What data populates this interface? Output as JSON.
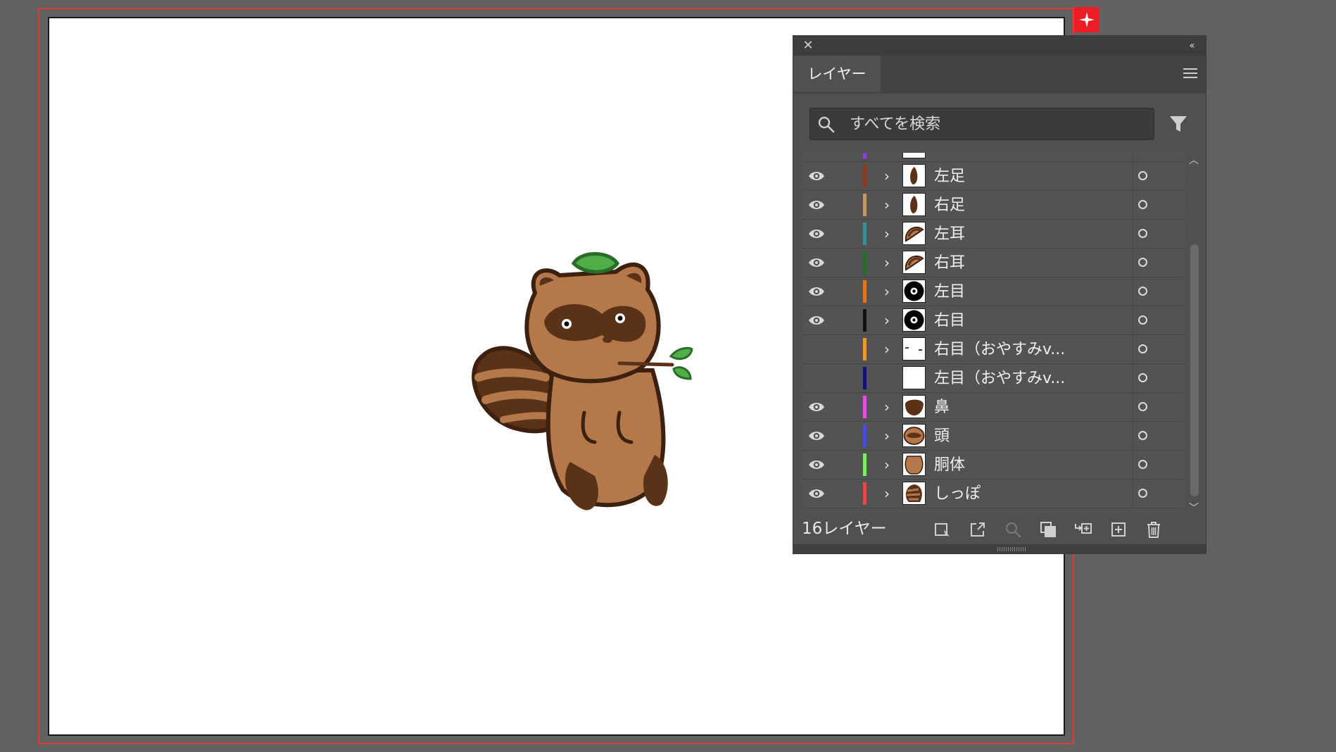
{
  "panel": {
    "close_glyph": "✕",
    "collapse_glyph": "‹‹",
    "tab_label": "レイヤー",
    "search_placeholder": "すべてを検索",
    "layer_count": "16レイヤー"
  },
  "layers": [
    {
      "name": "左足",
      "visible": true,
      "color": "#8b3a1e",
      "expandable": true,
      "thumb": "foot"
    },
    {
      "name": "右足",
      "visible": true,
      "color": "#c4996a",
      "expandable": true,
      "thumb": "foot"
    },
    {
      "name": "左耳",
      "visible": true,
      "color": "#3a8f95",
      "expandable": true,
      "thumb": "ear"
    },
    {
      "name": "右耳",
      "visible": true,
      "color": "#2a6b2a",
      "expandable": true,
      "thumb": "ear"
    },
    {
      "name": "左目",
      "visible": true,
      "color": "#e2731f",
      "expandable": true,
      "thumb": "eye"
    },
    {
      "name": "右目",
      "visible": true,
      "color": "#111111",
      "expandable": true,
      "thumb": "eye"
    },
    {
      "name": "右目（おやすみv...",
      "visible": false,
      "color": "#e89a30",
      "expandable": true,
      "thumb": "sleep"
    },
    {
      "name": "左目（おやすみv...",
      "visible": false,
      "color": "#13137a",
      "expandable": false,
      "thumb": "blank"
    },
    {
      "name": "鼻",
      "visible": true,
      "color": "#e04fe0",
      "expandable": true,
      "thumb": "nose"
    },
    {
      "name": "頭",
      "visible": true,
      "color": "#4b4bdc",
      "expandable": true,
      "thumb": "head"
    },
    {
      "name": "胴体",
      "visible": true,
      "color": "#7cef62",
      "expandable": true,
      "thumb": "body"
    },
    {
      "name": "しっぽ",
      "visible": true,
      "color": "#e24b4b",
      "expandable": true,
      "thumb": "tail"
    }
  ],
  "colors": {
    "fur": "#b4784a",
    "dark": "#5a3218",
    "leaf": "#4fae48",
    "leaf_dark": "#2a6d2a"
  }
}
